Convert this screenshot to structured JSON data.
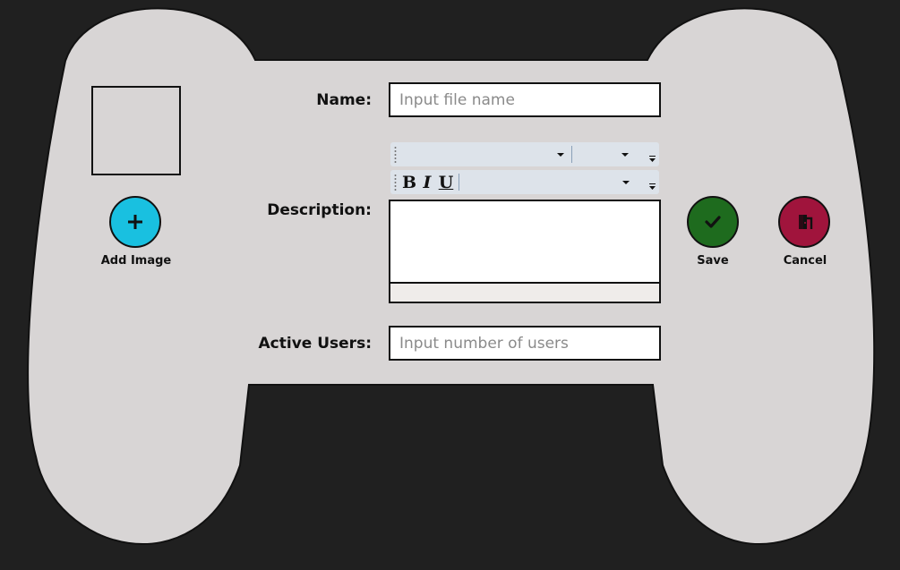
{
  "colors": {
    "page_background": "#202020",
    "controller_body": "#d8d5d5",
    "add_button": "#19c0e0",
    "save_button": "#1e6b1e",
    "cancel_button": "#a0143c"
  },
  "image_section": {
    "add_image_label": "Add Image",
    "add_icon": "plus-icon"
  },
  "form": {
    "name": {
      "label": "Name:",
      "value": "",
      "placeholder": "Input file name"
    },
    "description": {
      "label": "Description:",
      "value": "",
      "toolbar_row1": {
        "style_combo_value": "",
        "size_combo_value": ""
      },
      "toolbar_row2": {
        "bold_label": "B",
        "italic_label": "I",
        "underline_label": "U",
        "color_combo_value": ""
      }
    },
    "active_users": {
      "label": "Active Users:",
      "value": "",
      "placeholder": "Input number of users"
    }
  },
  "actions": {
    "save_label": "Save",
    "save_icon": "checkmark-icon",
    "cancel_label": "Cancel",
    "cancel_icon": "exit-door-icon"
  }
}
